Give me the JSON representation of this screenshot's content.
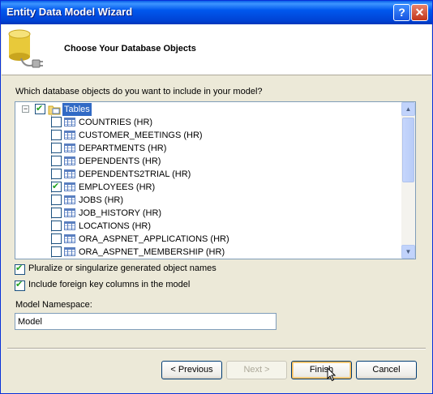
{
  "window": {
    "title": "Entity Data Model Wizard"
  },
  "header": {
    "title": "Choose Your Database Objects",
    "icon": "database-plug-icon"
  },
  "prompt": "Which database objects do you want to include in your model?",
  "tree": {
    "root": {
      "label": "Tables",
      "checked": true,
      "expanded": true
    },
    "items": [
      {
        "label": "COUNTRIES (HR)",
        "checked": false
      },
      {
        "label": "CUSTOMER_MEETINGS (HR)",
        "checked": false
      },
      {
        "label": "DEPARTMENTS (HR)",
        "checked": false
      },
      {
        "label": "DEPENDENTS (HR)",
        "checked": false
      },
      {
        "label": "DEPENDENTS2TRIAL (HR)",
        "checked": false
      },
      {
        "label": "EMPLOYEES (HR)",
        "checked": true
      },
      {
        "label": "JOBS (HR)",
        "checked": false
      },
      {
        "label": "JOB_HISTORY (HR)",
        "checked": false
      },
      {
        "label": "LOCATIONS (HR)",
        "checked": false
      },
      {
        "label": "ORA_ASPNET_APPLICATIONS (HR)",
        "checked": false
      },
      {
        "label": "ORA_ASPNET_MEMBERSHIP (HR)",
        "checked": false
      }
    ]
  },
  "options": {
    "pluralize": {
      "label": "Pluralize or singularize generated object names",
      "checked": true
    },
    "foreign_keys": {
      "label": "Include foreign key columns in the model",
      "checked": true
    }
  },
  "namespace": {
    "label": "Model Namespace:",
    "value": "Model"
  },
  "buttons": {
    "previous": "< Previous",
    "next": "Next >",
    "finish": "Finish",
    "cancel": "Cancel"
  },
  "colors": {
    "titlebar": "#0054E3",
    "selection": "#316AC5",
    "check": "#21A121"
  }
}
